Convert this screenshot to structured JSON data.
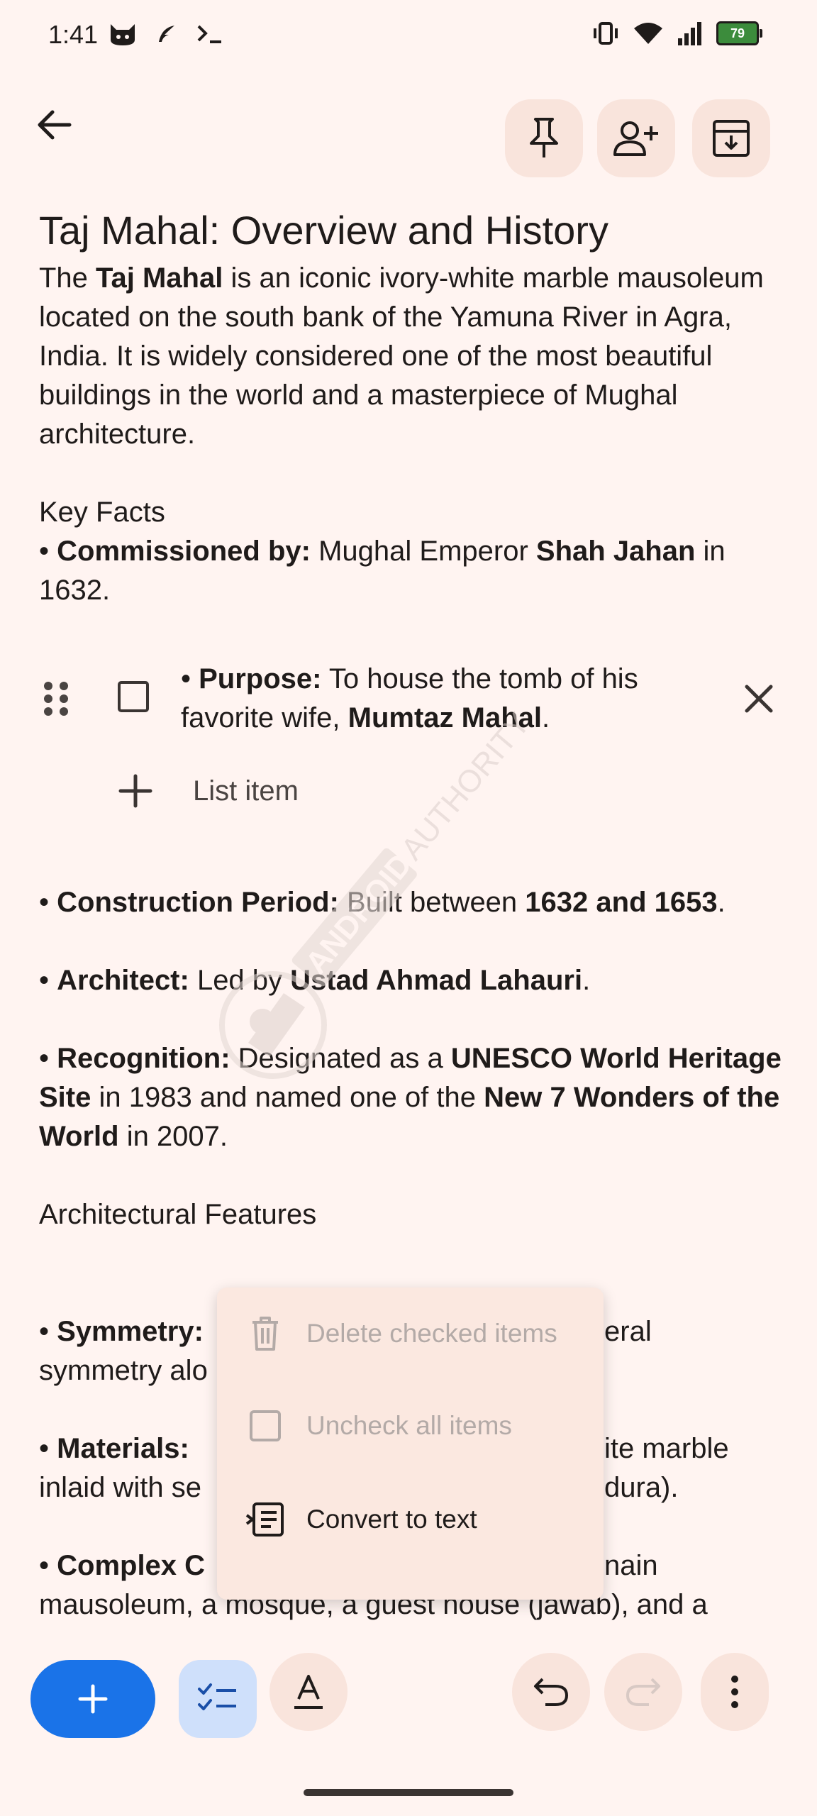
{
  "status_bar": {
    "time": "1:41",
    "battery": "79",
    "icons": [
      "cat-icon",
      "feather-icon",
      "terminal-icon",
      "vibrate-icon",
      "wifi-icon",
      "signal-icon",
      "battery-icon"
    ]
  },
  "top_bar": {
    "back": "back-arrow-icon",
    "actions": [
      "pin-icon",
      "add-collaborator-icon",
      "archive-icon"
    ]
  },
  "note": {
    "title": "Taj Mahal: Overview and History",
    "intro": {
      "t1": "The ",
      "b1": "Taj Mahal",
      "t2": " is an iconic ivory-white marble mausoleum located on the south bank of the Yamuna River in Agra, India. It is widely considered one of the most beautiful buildings in the world and a masterpiece of Mughal architecture."
    },
    "key_facts_heading": "Key Facts",
    "commissioned": {
      "bullet": "• ",
      "b1": "Commissioned by:",
      "t1": " Mughal Emperor ",
      "b2": "Shah Jahan",
      "t2": " in 1632."
    },
    "checklist_item": {
      "bullet": "• ",
      "b1": "Purpose:",
      "t1": " To house the tomb of his favorite wife, ",
      "b2": "Mumtaz Mahal",
      "t2": "."
    },
    "add_list_item": "List item",
    "construction": {
      "bullet": "• ",
      "b1": "Construction Period:",
      "t1": " Built between ",
      "b2": "1632 and 1653",
      "t2": "."
    },
    "architect": {
      "bullet": "• ",
      "b1": "Architect:",
      "t1": " Led by ",
      "b2": "Ustad Ahmad Lahauri",
      "t2": "."
    },
    "recognition": {
      "bullet": "• ",
      "b1": "Recognition:",
      "t1": " Designated as a ",
      "b2": "UNESCO World Heritage Site",
      "t2": " in 1983 and named one of the ",
      "b3": "New 7 Wonders of the World",
      "t3": " in 2007."
    },
    "architectural_heading": "Architectural Features",
    "symmetry": {
      "bullet": "• ",
      "b1": "Symmetry:",
      "t1_right": "eral",
      "line2": "symmetry alo"
    },
    "materials": {
      "bullet": "• ",
      "b1": "Materials:",
      "t1_right": "ite marble",
      "line2_left": "inlaid with se",
      "line2_right": "dura)."
    },
    "complex": {
      "bullet": "• ",
      "b1": "Complex C",
      "t1_right": "nain",
      "line2": "mausoleum, a mosque, a guest house (jawab), and a"
    }
  },
  "menu": {
    "items": [
      {
        "label": "Delete checked items",
        "icon": "trash-icon",
        "enabled": false
      },
      {
        "label": "Uncheck all items",
        "icon": "empty-checkbox-icon",
        "enabled": false
      },
      {
        "label": "Convert to text",
        "icon": "convert-to-text-icon",
        "enabled": true
      }
    ]
  },
  "watermark": {
    "text": "ANDROID AUTHORITY"
  },
  "toolbar": {
    "icons": [
      "plus-icon",
      "checklist-icon",
      "text-format-icon",
      "undo-icon",
      "redo-icon",
      "more-vert-icon"
    ]
  }
}
